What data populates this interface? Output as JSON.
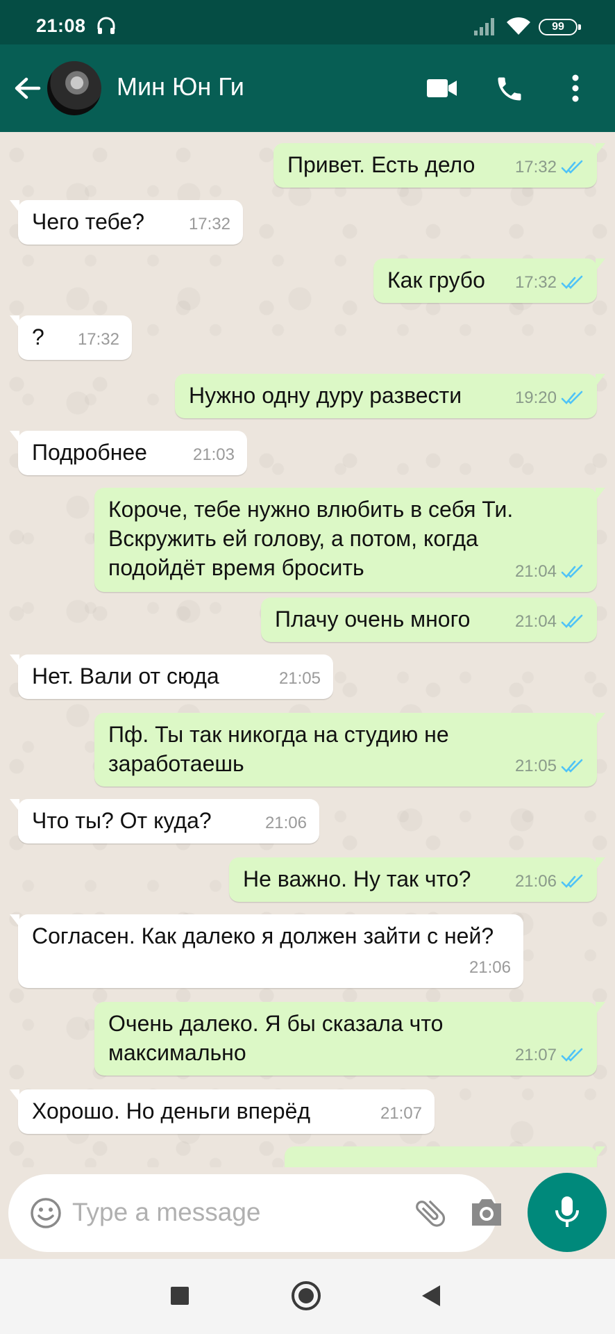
{
  "status_bar": {
    "time": "21:08",
    "battery": "99",
    "icons": [
      "headphones-icon",
      "signal-icon",
      "wifi-icon",
      "battery-icon"
    ]
  },
  "header": {
    "contact_name": "Мин Юн Ги",
    "icons": [
      "back-arrow-icon",
      "video-call-icon",
      "phone-icon",
      "more-vert-icon"
    ]
  },
  "messages": [
    {
      "dir": "out",
      "text": "Привет. Есть дело",
      "time": "17:32",
      "read": true
    },
    {
      "dir": "in",
      "text": "Чего тебе?",
      "time": "17:32"
    },
    {
      "dir": "out",
      "text": "Как грубо",
      "time": "17:32",
      "read": true
    },
    {
      "dir": "in",
      "text": "?",
      "time": "17:32"
    },
    {
      "dir": "out",
      "text": "Нужно одну дуру развести",
      "time": "19:20",
      "read": true
    },
    {
      "dir": "in",
      "text": "Подробнее",
      "time": "21:03"
    },
    {
      "dir": "out",
      "text": "Короче, тебе нужно влюбить в себя Ти. Вскружить ей голову, а потом, когда подойдёт время бросить",
      "time": "21:04",
      "read": true
    },
    {
      "dir": "out",
      "text": "Плачу очень много",
      "time": "21:04",
      "read": true
    },
    {
      "dir": "in",
      "text": "Нет. Вали от сюда",
      "time": "21:05"
    },
    {
      "dir": "out",
      "text": "Пф. Ты так никогда на студию не заработаешь",
      "time": "21:05",
      "read": true
    },
    {
      "dir": "in",
      "text": "Что ты? От куда?",
      "time": "21:06"
    },
    {
      "dir": "out",
      "text": "Не важно. Ну так что?",
      "time": "21:06",
      "read": true
    },
    {
      "dir": "in",
      "text": "Согласен. Как далеко я должен зайти с ней?",
      "time": "21:06"
    },
    {
      "dir": "out",
      "text": "Очень далеко. Я бы сказала что максимально",
      "time": "21:07",
      "read": true
    },
    {
      "dir": "in",
      "text": "Хорошо. Но деньги вперёд",
      "time": "21:07"
    }
  ],
  "input": {
    "placeholder": "Type a message",
    "icons": [
      "emoji-icon",
      "attach-icon",
      "camera-icon",
      "mic-icon"
    ]
  },
  "colors": {
    "header": "#075e54",
    "status_bar": "#054d44",
    "outgoing_bubble": "#dcf8c6",
    "incoming_bubble": "#ffffff",
    "read_ticks": "#4fc3f7",
    "mic_button": "#00897b"
  }
}
